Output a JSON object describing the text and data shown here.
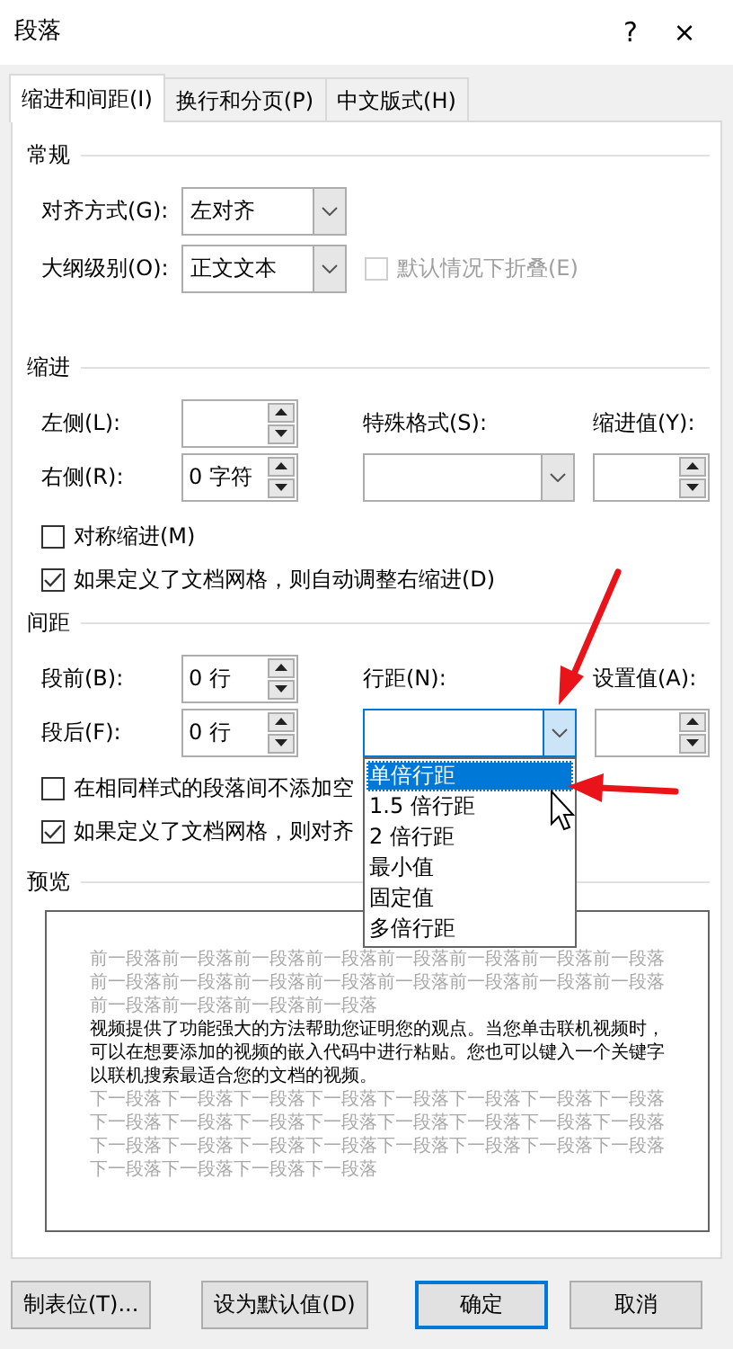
{
  "window": {
    "title": "段落",
    "help": "?",
    "close": "×"
  },
  "tabs": [
    {
      "label": "缩进和间距(I)",
      "selected": true
    },
    {
      "label": "换行和分页(P)",
      "selected": false
    },
    {
      "label": "中文版式(H)",
      "selected": false
    }
  ],
  "general": {
    "heading": "常规",
    "alignment": {
      "label": "对齐方式(G):",
      "value": "左对齐"
    },
    "outline_level": {
      "label": "大纲级别(O):",
      "value": "正文文本"
    },
    "collapsed": {
      "label": "默认情况下折叠(E)",
      "checked": false,
      "disabled": true
    }
  },
  "indent": {
    "heading": "缩进",
    "left": {
      "label": "左侧(L):"
    },
    "right": {
      "label": "右侧(R):",
      "value": "0 字符"
    },
    "special": {
      "label": "特殊格式(S):"
    },
    "by": {
      "label": "缩进值(Y):"
    },
    "checkboxes": [
      {
        "label": "对称缩进(M)",
        "checked": false
      },
      {
        "label": "如果定义了文档网格，则自动调整右缩进(D)",
        "checked": true
      }
    ]
  },
  "spacing": {
    "heading": "间距",
    "before": {
      "label": "段前(B):",
      "value": "0 行"
    },
    "after": {
      "label": "段后(F):",
      "value": "0 行"
    },
    "line_spacing": {
      "label": "行距(N):",
      "expanded": true,
      "options": [
        {
          "label": "单倍行距",
          "selected": true
        },
        {
          "label": "1.5 倍行距",
          "selected": false
        },
        {
          "label": "2 倍行距",
          "selected": false
        },
        {
          "label": "最小值",
          "selected": false
        },
        {
          "label": "固定值",
          "selected": false
        },
        {
          "label": "多倍行距",
          "selected": false
        }
      ]
    },
    "at": {
      "label": "设置值(A):"
    },
    "checkboxes": [
      {
        "label": "在相同样式的段落间不添加空",
        "checked": false
      },
      {
        "label": "如果定义了文档网格，则对齐",
        "checked": true
      }
    ]
  },
  "preview": {
    "heading": "预览",
    "previous": "前一段落前一段落前一段落前一段落前一段落前一段落前一段落前一段落前一段落前一段落前一段落前一段落前一段落前一段落前一段落前一段落前一段落前一段落前一段落前一段落",
    "sample": "视频提供了功能强大的方法帮助您证明您的观点。当您单击联机视频时，可以在想要添加的视频的嵌入代码中进行粘贴。您也可以键入一个关键字以联机搜索最适合您的文档的视频。",
    "next": "下一段落下一段落下一段落下一段落下一段落下一段落下一段落下一段落下一段落下一段落下一段落下一段落下一段落下一段落下一段落下一段落下一段落下一段落下一段落下一段落下一段落下一段落下一段落下一段落下一段落下一段落下一段落下一段落"
  },
  "buttons": [
    {
      "label": "制表位(T)...",
      "default": false
    },
    {
      "label": "设为默认值(D)",
      "default": false
    },
    {
      "label": "确定",
      "default": true
    },
    {
      "label": "取消",
      "default": false
    }
  ]
}
